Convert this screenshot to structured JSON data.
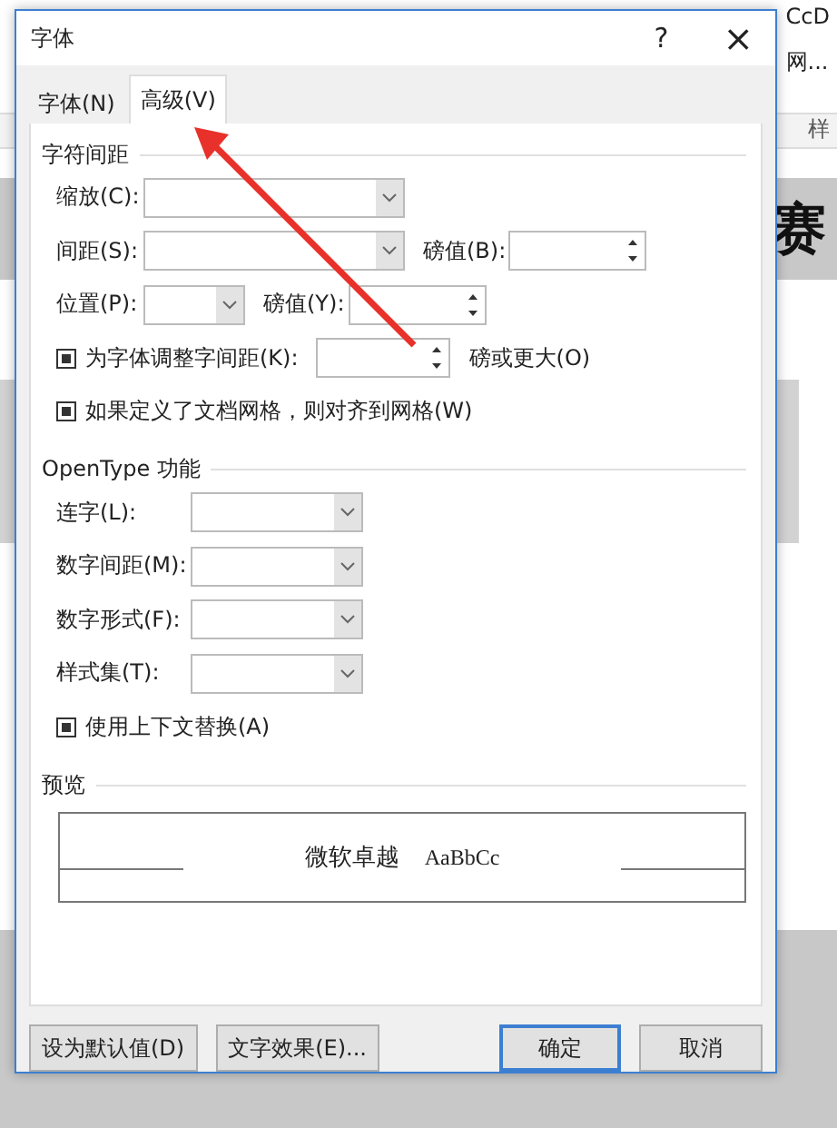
{
  "background": {
    "ribbon_texts": [
      "CcD",
      "网..."
    ],
    "styles_label": "样",
    "doc_char": "赛"
  },
  "window": {
    "title": "字体",
    "help": "?",
    "close": "×"
  },
  "tabs": [
    {
      "label": "字体(N)",
      "selected": false
    },
    {
      "label": "高级(V)",
      "selected": true
    }
  ],
  "sections": [
    {
      "heading": "字符间距",
      "rows": [
        {
          "items": [
            {
              "kind": "label",
              "text": "缩放(C):"
            },
            {
              "kind": "combo"
            }
          ]
        },
        {
          "items": [
            {
              "kind": "label",
              "text": "间距(S):"
            },
            {
              "kind": "combo"
            },
            {
              "kind": "label",
              "text": "磅值(B):"
            },
            {
              "kind": "spin"
            }
          ]
        },
        {
          "items": [
            {
              "kind": "label",
              "text": "位置(P):"
            },
            {
              "kind": "combo"
            },
            {
              "kind": "label",
              "text": "磅值(Y):"
            },
            {
              "kind": "spin"
            }
          ]
        },
        {
          "items": [
            {
              "kind": "checkbox",
              "text": "为字体调整字间距(K):",
              "indeterminate": true
            },
            {
              "kind": "spin"
            },
            {
              "kind": "text",
              "text": "磅或更大(O)"
            }
          ]
        },
        {
          "items": [
            {
              "kind": "checkbox",
              "text": "如果定义了文档网格，则对齐到网格(W)",
              "indeterminate": true
            }
          ]
        }
      ]
    },
    {
      "heading": "OpenType 功能",
      "rows": [
        {
          "items": [
            {
              "kind": "label",
              "text": "连字(L):"
            },
            {
              "kind": "combo"
            }
          ]
        },
        {
          "items": [
            {
              "kind": "label",
              "text": "数字间距(M):"
            },
            {
              "kind": "combo"
            }
          ]
        },
        {
          "items": [
            {
              "kind": "label",
              "text": "数字形式(F):"
            },
            {
              "kind": "combo"
            }
          ]
        },
        {
          "items": [
            {
              "kind": "label",
              "text": "样式集(T):"
            },
            {
              "kind": "combo"
            }
          ]
        },
        {
          "items": [
            {
              "kind": "checkbox",
              "text": "使用上下文替换(A)",
              "indeterminate": true
            }
          ]
        }
      ]
    }
  ],
  "preview": {
    "heading": "预览",
    "cjk_text": "微软卓越",
    "latin_text": "AaBbCc"
  },
  "buttons": [
    {
      "label": "设为默认值(D)",
      "default": false
    },
    {
      "label": "文字效果(E)...",
      "default": false
    },
    {
      "label": "确定",
      "default": true
    },
    {
      "label": "取消",
      "default": false
    }
  ]
}
